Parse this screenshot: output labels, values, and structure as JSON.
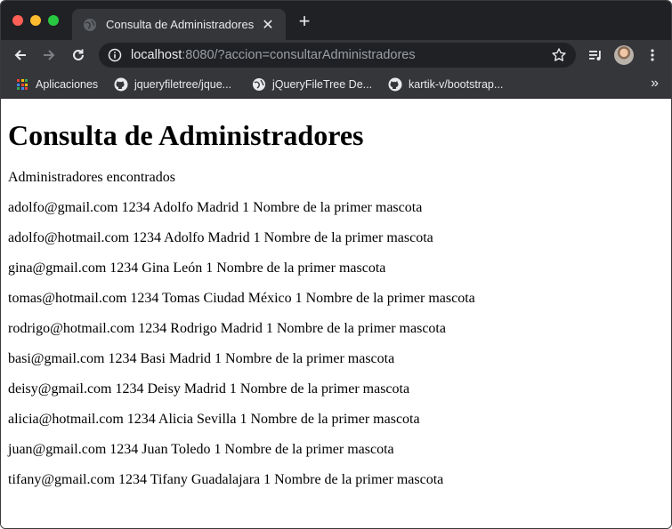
{
  "browser": {
    "tab": {
      "title": "Consulta de Administradores",
      "favicon": "globe-icon"
    },
    "address_bar": {
      "host": "localhost",
      "rest": ":8080/?accion=consultarAdministradores"
    },
    "bookmarks": [
      {
        "label": "Aplicaciones",
        "icon": "apps-grid-icon"
      },
      {
        "label": "jqueryfiletree/jque...",
        "icon": "github-icon"
      },
      {
        "label": "jQueryFileTree De...",
        "icon": "globe-icon"
      },
      {
        "label": "kartik-v/bootstrap...",
        "icon": "github-icon"
      }
    ],
    "colors": {
      "tabstrip": "#202124",
      "toolbar": "#35363a",
      "text": "#e8eaed"
    }
  },
  "page": {
    "heading": "Consulta de Administradores",
    "subtitle": "Administradores encontrados",
    "rows": [
      "adolfo@gmail.com 1234 Adolfo Madrid 1 Nombre de la primer mascota",
      "adolfo@hotmail.com 1234 Adolfo Madrid 1 Nombre de la primer mascota",
      "gina@gmail.com 1234 Gina León 1 Nombre de la primer mascota",
      "tomas@hotmail.com 1234 Tomas Ciudad México 1 Nombre de la primer mascota",
      "rodrigo@hotmail.com 1234 Rodrigo Madrid 1 Nombre de la primer mascota",
      "basi@gmail.com 1234 Basi Madrid 1 Nombre de la primer mascota",
      "deisy@gmail.com 1234 Deisy Madrid 1 Nombre de la primer mascota",
      "alicia@hotmail.com 1234 Alicia Sevilla 1 Nombre de la primer mascota",
      "juan@gmail.com 1234 Juan Toledo 1 Nombre de la primer mascota",
      "tifany@gmail.com 1234 Tifany Guadalajara 1 Nombre de la primer mascota"
    ]
  }
}
